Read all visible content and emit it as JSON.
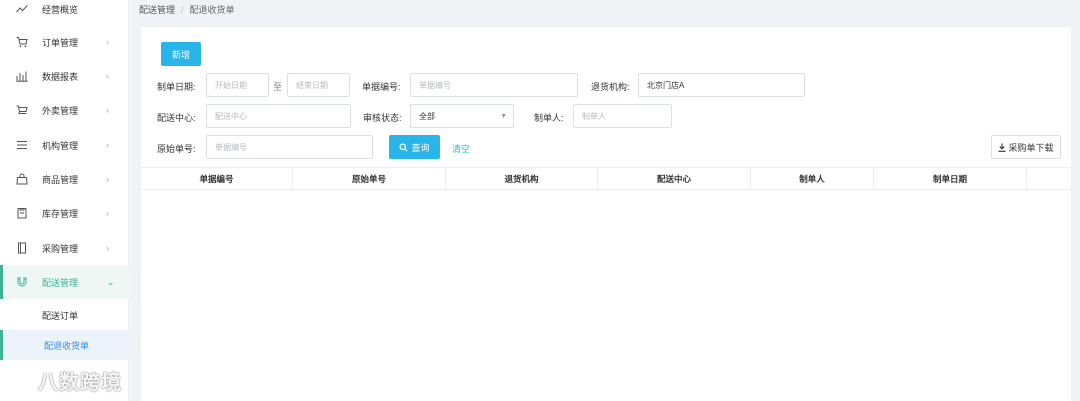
{
  "sidebar": {
    "items": [
      {
        "label": "经营概览",
        "icon": "trend-icon",
        "has_chevron": false
      },
      {
        "label": "订单管理",
        "icon": "cart-icon",
        "has_chevron": true
      },
      {
        "label": "数据报表",
        "icon": "bar-chart-icon",
        "has_chevron": true
      },
      {
        "label": "外卖管理",
        "icon": "delivery-cart-icon",
        "has_chevron": true
      },
      {
        "label": "机构管理",
        "icon": "menu-lines-icon",
        "has_chevron": true
      },
      {
        "label": "商品管理",
        "icon": "bag-icon",
        "has_chevron": true
      },
      {
        "label": "库存管理",
        "icon": "clipboard-icon",
        "has_chevron": true
      },
      {
        "label": "采购管理",
        "icon": "book-icon",
        "has_chevron": true
      },
      {
        "label": "配送管理",
        "icon": "magnet-icon",
        "has_chevron": true,
        "expanded": true
      }
    ],
    "subitems": [
      {
        "label": "配送订单"
      },
      {
        "label": "配退收货单",
        "selected": true
      }
    ]
  },
  "watermark": {
    "text": "八数跨境"
  },
  "breadcrumb": {
    "parent": "配送管理",
    "separator": "/",
    "current": "配退收货单"
  },
  "toolbar": {
    "add_label": "新增",
    "search_label": "查询",
    "clear_label": "清空",
    "download_label": "采购单下载"
  },
  "filters": {
    "date_label": "制单日期:",
    "date_start_placeholder": "开始日期",
    "date_to": "至",
    "date_end_placeholder": "结束日期",
    "doc_no_label": "单据编号:",
    "doc_no_placeholder": "单据编号",
    "return_org_label": "退货机构:",
    "return_org_value": "北京门店A",
    "dist_center_label": "配送中心:",
    "dist_center_placeholder": "配送中心",
    "audit_label": "审核状态:",
    "audit_value": "全部",
    "creator_label": "制单人:",
    "creator_placeholder": "制单人",
    "orig_no_label": "原始单号:",
    "orig_no_placeholder": "单据编号"
  },
  "table": {
    "columns": [
      "单据编号",
      "原始单号",
      "退货机构",
      "配送中心",
      "制单人",
      "制单日期"
    ],
    "rows": []
  },
  "colors": {
    "accent": "#3fb195",
    "primary": "#29b5ea",
    "link_blue": "#2d8cf0"
  }
}
